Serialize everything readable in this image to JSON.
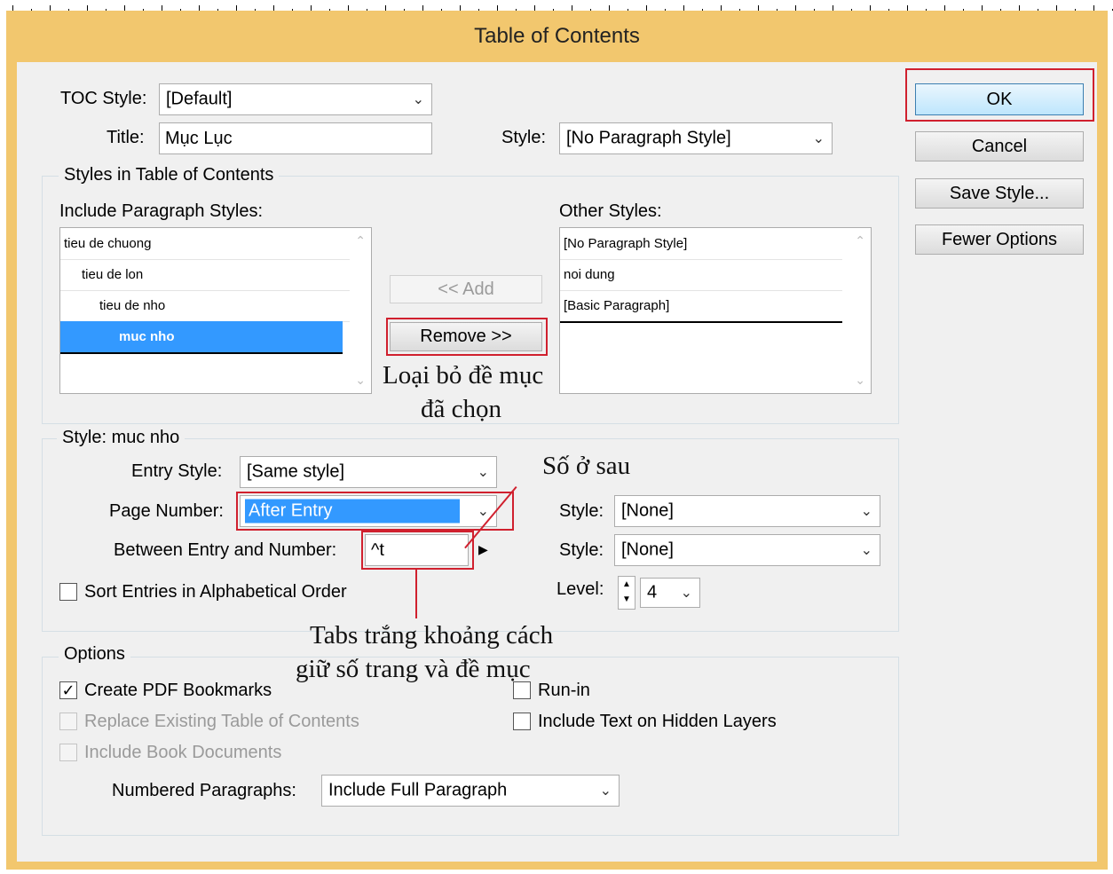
{
  "dialog": {
    "title": "Table of Contents"
  },
  "top": {
    "toc_style_label": "TOC Style:",
    "toc_style_value": "[Default]",
    "title_label": "Title:",
    "title_value": "Mục Lục",
    "style_label": "Style:",
    "style_value": "[No Paragraph Style]"
  },
  "buttons": {
    "ok": "OK",
    "cancel": "Cancel",
    "save_style": "Save Style...",
    "fewer_options": "Fewer Options",
    "add": "<< Add",
    "remove": "Remove >>"
  },
  "styles_group": {
    "title": "Styles in Table of Contents",
    "include_label": "Include Paragraph Styles:",
    "include_items": [
      "tieu de chuong",
      "tieu de lon",
      "tieu de nho",
      "muc nho"
    ],
    "selected_index": 3,
    "other_label": "Other Styles:",
    "other_items": [
      "[No Paragraph Style]",
      "noi dung",
      "[Basic Paragraph]"
    ]
  },
  "style_group": {
    "title": "Style: muc nho",
    "entry_style_label": "Entry Style:",
    "entry_style_value": "[Same style]",
    "page_number_label": "Page Number:",
    "page_number_value": "After Entry",
    "page_number_style_label": "Style:",
    "page_number_style_value": "[None]",
    "between_label": "Between Entry and Number:",
    "between_value": "^t",
    "between_style_label": "Style:",
    "between_style_value": "[None]",
    "sort_label": "Sort Entries in Alphabetical Order",
    "level_label": "Level:",
    "level_value": "4"
  },
  "options_group": {
    "title": "Options",
    "create_pdf": "Create PDF Bookmarks",
    "replace_existing": "Replace Existing Table of Contents",
    "include_book": "Include Book Documents",
    "run_in": "Run-in",
    "include_hidden": "Include Text on Hidden Layers",
    "numbered_label": "Numbered Paragraphs:",
    "numbered_value": "Include Full Paragraph"
  },
  "annotations": {
    "remove_note_line1": "Loại bỏ đề mục",
    "remove_note_line2": "đã chọn",
    "after_note": "Số ở sau",
    "tab_note_line1": "Tabs trắng khoảng cách",
    "tab_note_line2": "giữ số trang và đề mục"
  },
  "icons": {
    "dropdown": "chevron-down-icon",
    "check": "checkmark-icon",
    "play": "triangle-right-icon",
    "spinner": "spinner-icon"
  },
  "colors": {
    "window_frame": "#f2c76e",
    "client_bg": "#f0f0f0",
    "selection": "#3399ff",
    "annotation_red": "#d0202e"
  }
}
